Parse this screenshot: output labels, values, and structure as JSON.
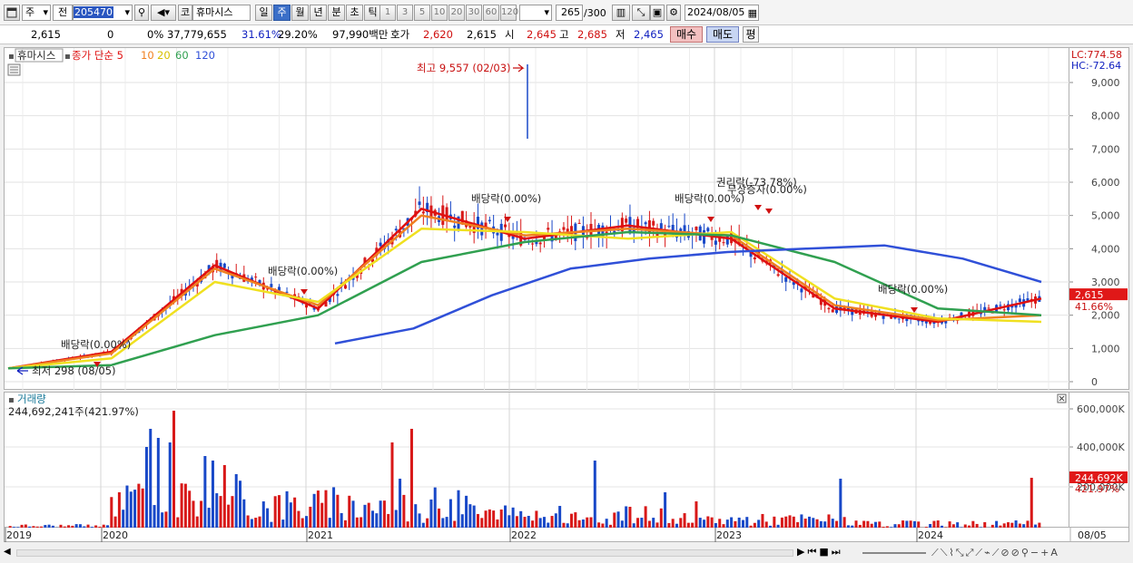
{
  "toolbar": {
    "type_label": "주",
    "market_label": "전",
    "code": "205470",
    "stock_name": "휴마시스",
    "stock_prefix": "코",
    "periods": [
      "일",
      "주",
      "월",
      "년",
      "분",
      "초",
      "틱"
    ],
    "active_period": "주",
    "intervals": [
      "1",
      "3",
      "5",
      "10",
      "20",
      "30",
      "60",
      "120"
    ],
    "count": "265",
    "count_max": "/300",
    "date": "2024/08/05"
  },
  "info": {
    "price": "2,615",
    "change": "0",
    "change_pct": "0%",
    "volume": "37,779,655",
    "pct1": "31.61%",
    "pct2": "29.20%",
    "amount": "97,990백만",
    "hoga_label": "호가",
    "hoga_ask": "2,620",
    "hoga_bid": "2,615",
    "open_label": "시",
    "open": "2,645",
    "high_label": "고",
    "high": "2,685",
    "low_label": "저",
    "low": "2,465",
    "buy_button": "매수",
    "sell_button": "매도",
    "eval_button": "평"
  },
  "legend": {
    "name": "휴마시스",
    "series_label": "종가 단순",
    "ma": [
      "5",
      "10",
      "20",
      "60",
      "120"
    ]
  },
  "annotations": {
    "high": "최고 9,557 (02/03)",
    "low": "최저 298 (08/05)",
    "div1": "배당락(0.00%)",
    "div2": "배당락(0.00%)",
    "div3": "배당락(0.00%)",
    "div4": "배당락(0.00%)",
    "div5": "배당락(0.00%)",
    "rights": "권리락(-73.78%)",
    "bonus": "무상증자(0.00%)"
  },
  "price_axis": {
    "lc": "LC:774.58",
    "hc": "HC:-72.64",
    "ticks": [
      "9,000",
      "8,000",
      "7,000",
      "6,000",
      "5,000",
      "4,000",
      "3,000",
      "2,000",
      "1,000",
      "0"
    ],
    "current": "2,615",
    "current_pct": "41.66%"
  },
  "volume": {
    "title": "거래량",
    "summary": "244,692,241주(421.97%)",
    "ticks": [
      "600,000K",
      "400,000K",
      "200,000K"
    ],
    "current": "244,692K",
    "current_pct": "421.97%"
  },
  "x_axis": {
    "labels": [
      "2019",
      "2020",
      "2021",
      "2022",
      "2023",
      "2024"
    ],
    "right_label": "08/05"
  },
  "colors": {
    "up": "#d81818",
    "down": "#1848c8",
    "ma5": "#e01010",
    "ma10": "#f08020",
    "ma20": "#f0e020",
    "ma60": "#30a050",
    "ma120": "#3050d8"
  },
  "chart_data": {
    "type": "line",
    "title": "",
    "xlabel": "",
    "ylabel": "",
    "ylim": [
      0,
      10000
    ],
    "x": [
      "2019",
      "2020",
      "2021",
      "2022",
      "2023",
      "2024"
    ],
    "series": [
      {
        "name": "5",
        "values": [
          400,
          900,
          3500,
          2200,
          5200,
          4300,
          4700,
          4300,
          2200,
          1800,
          2500
        ]
      },
      {
        "name": "10",
        "values": [
          400,
          850,
          3400,
          2300,
          5000,
          4400,
          4600,
          4400,
          2300,
          1850,
          2000
        ]
      },
      {
        "name": "20",
        "values": [
          400,
          700,
          3000,
          2400,
          4600,
          4500,
          4300,
          4500,
          2500,
          1900,
          1800
        ]
      },
      {
        "name": "60",
        "values": [
          400,
          500,
          1400,
          2000,
          3600,
          4200,
          4500,
          4400,
          3600,
          2200,
          2000
        ]
      },
      {
        "name": "120",
        "values": [
          1150,
          1600,
          2600,
          3400,
          3700,
          3900,
          4000,
          4100,
          3700,
          3000
        ]
      }
    ]
  }
}
